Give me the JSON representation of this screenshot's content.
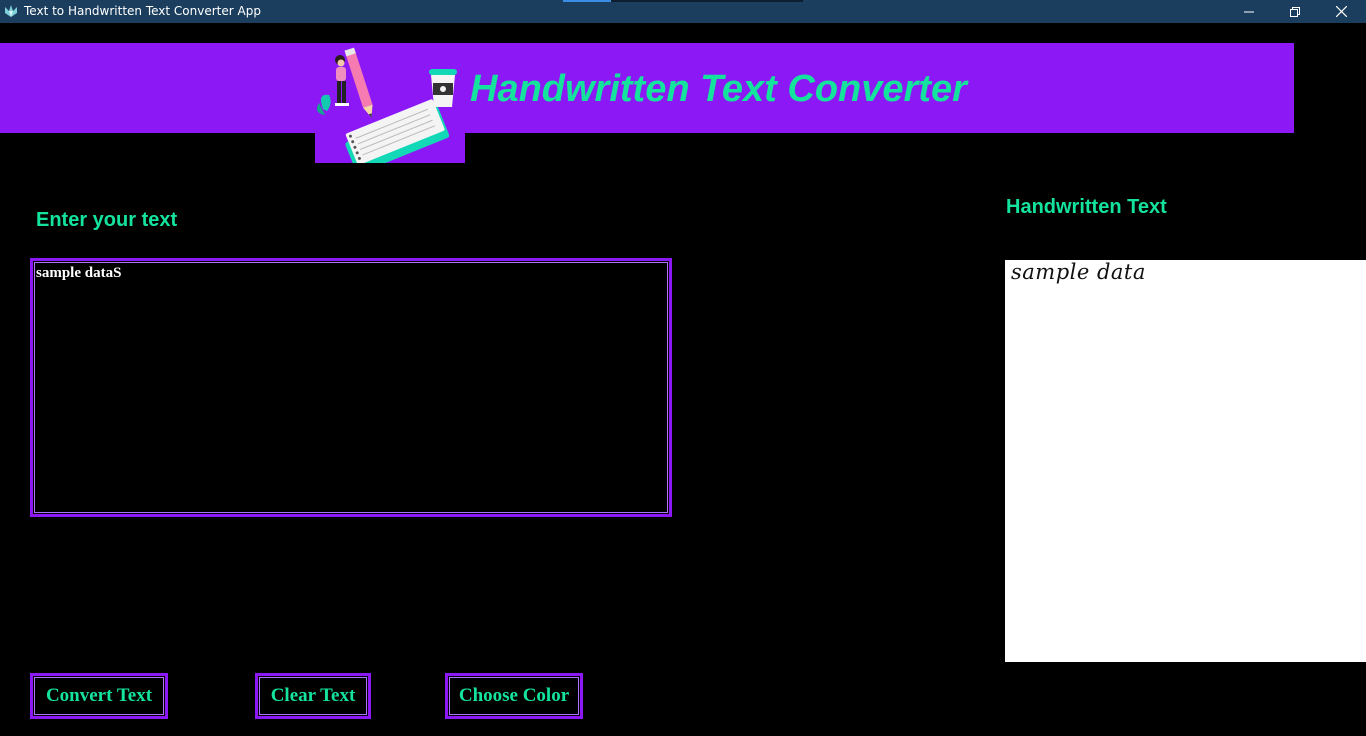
{
  "window": {
    "title": "Text to Handwritten Text Converter App"
  },
  "banner": {
    "title": "Handwritten Text Converter",
    "illustration_icon": "person-writing-notebook-illustration"
  },
  "input": {
    "label": "Enter your text",
    "value": "sample dataS"
  },
  "output": {
    "label": "Handwritten Text",
    "rendered_text": "sample data"
  },
  "buttons": {
    "convert": "Convert Text",
    "clear": "Clear Text",
    "color": "Choose Color"
  },
  "colors": {
    "background": "#000000",
    "accent_purple": "#8c18f6",
    "accent_green": "#13e39c",
    "titlebar": "#1b3e5f"
  }
}
